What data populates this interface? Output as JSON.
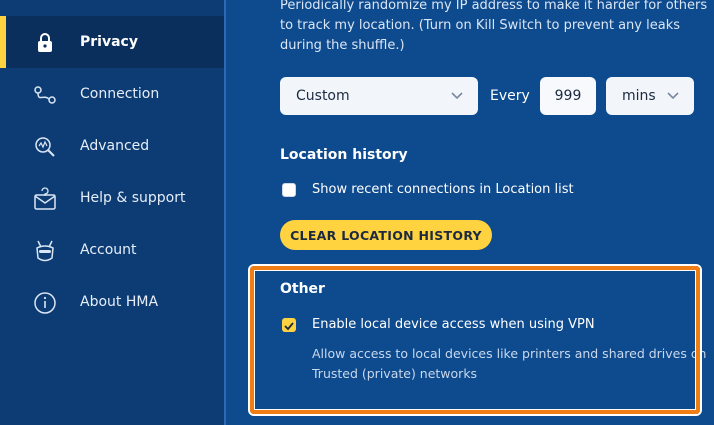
{
  "sidebar": {
    "items": [
      {
        "label": "Privacy",
        "icon": "lock-icon",
        "active": true
      },
      {
        "label": "Connection",
        "icon": "connection-icon"
      },
      {
        "label": "Advanced",
        "icon": "advanced-search-icon"
      },
      {
        "label": "Help & support",
        "icon": "mail-help-icon"
      },
      {
        "label": "Account",
        "icon": "donkey-mask-icon"
      },
      {
        "label": "About HMA",
        "icon": "info-icon"
      }
    ]
  },
  "main": {
    "shuffle_description": "Periodically randomize my IP address to make it harder for others to track my location. (Turn on Kill Switch to prevent any leaks during the shuffle.)",
    "interval": {
      "mode_value": "Custom",
      "every_label": "Every",
      "number_value": "999",
      "unit_value": "mins"
    },
    "location_history": {
      "title": "Location history",
      "checkbox_label": "Show recent connections in Location list",
      "checked": false,
      "clear_button": "CLEAR LOCATION HISTORY"
    },
    "other": {
      "title": "Other",
      "checkbox_label": "Enable local device access when using VPN",
      "checked": true,
      "description": "Allow access to local devices like printers and shared drives on Trusted (private) networks"
    }
  },
  "colors": {
    "accent": "#ffd23f",
    "highlight": "#f07e15",
    "background": "#0d4a8e",
    "sidebar": "#0c3c73"
  }
}
